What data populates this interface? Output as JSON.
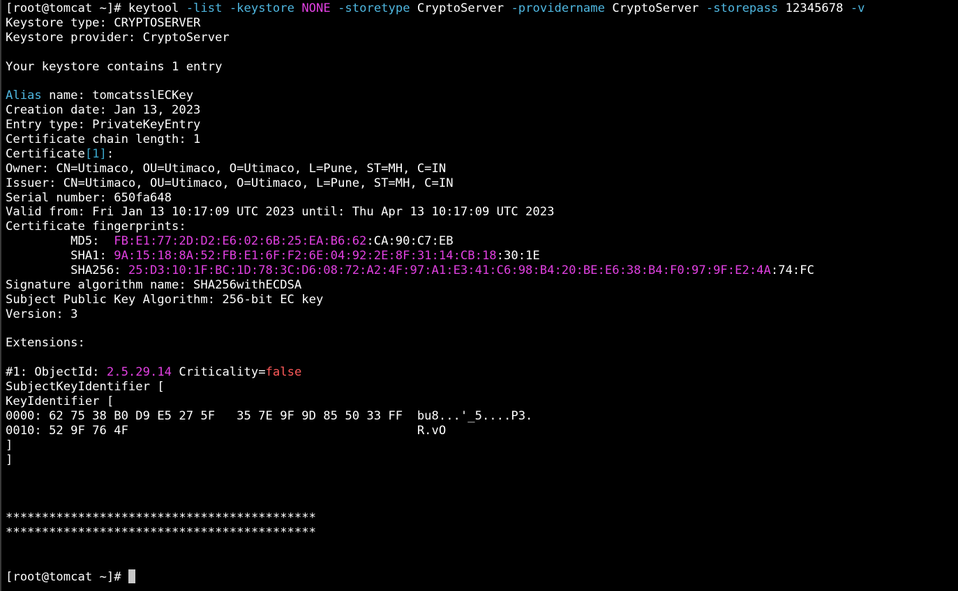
{
  "colors": {
    "background": "#000000",
    "default": "#ffffff",
    "cyan": "#4fb7e0",
    "magenta": "#e040e0",
    "red": "#ff5a5a",
    "bracket_cyan": "#3aa6c9",
    "cursor": "#c8c8c8"
  },
  "terminal": {
    "lines": [
      [
        {
          "t": "[root@tomcat ~]# keytool "
        },
        {
          "t": "-list",
          "c": "cyan"
        },
        {
          "t": " "
        },
        {
          "t": "-keystore",
          "c": "cyan"
        },
        {
          "t": " "
        },
        {
          "t": "NONE",
          "c": "magenta"
        },
        {
          "t": " "
        },
        {
          "t": "-storetype",
          "c": "cyan"
        },
        {
          "t": " CryptoServer "
        },
        {
          "t": "-providername",
          "c": "cyan"
        },
        {
          "t": " CryptoServer "
        },
        {
          "t": "-storepass",
          "c": "cyan"
        },
        {
          "t": " 12345678 "
        },
        {
          "t": "-v",
          "c": "cyan"
        }
      ],
      [
        {
          "t": "Keystore type: CRYPTOSERVER"
        }
      ],
      [
        {
          "t": "Keystore provider: CryptoServer"
        }
      ],
      [
        {
          "t": ""
        }
      ],
      [
        {
          "t": "Your keystore contains 1 entry"
        }
      ],
      [
        {
          "t": ""
        }
      ],
      [
        {
          "t": "Alias",
          "c": "cyan"
        },
        {
          "t": " name: tomcatsslECKey"
        }
      ],
      [
        {
          "t": "Creation date: Jan 13, 2023"
        }
      ],
      [
        {
          "t": "Entry type: PrivateKeyEntry"
        }
      ],
      [
        {
          "t": "Certificate chain length: 1"
        }
      ],
      [
        {
          "t": "Certificate"
        },
        {
          "t": "[1]",
          "c": "bracket_cyan"
        },
        {
          "t": ":"
        }
      ],
      [
        {
          "t": "Owner: CN=Utimaco, OU=Utimaco, O=Utimaco, L=Pune, ST=MH, C=IN"
        }
      ],
      [
        {
          "t": "Issuer: CN=Utimaco, OU=Utimaco, O=Utimaco, L=Pune, ST=MH, C=IN"
        }
      ],
      [
        {
          "t": "Serial number: 650fa648"
        }
      ],
      [
        {
          "t": "Valid from: Fri Jan 13 10:17:09 UTC 2023 until: Thu Apr 13 10:17:09 UTC 2023"
        }
      ],
      [
        {
          "t": "Certificate fingerprints:"
        }
      ],
      [
        {
          "t": "         MD5:  "
        },
        {
          "t": "FB:E1:77:2D:D2:E6:02:6B:25:EA:B6:62",
          "c": "magenta"
        },
        {
          "t": ":CA:90:C7:EB"
        }
      ],
      [
        {
          "t": "         SHA1: "
        },
        {
          "t": "9A:15:18:8A:52:FB:E1:6F:F2:6E:04:92:2E:8F:31:14:CB:18",
          "c": "magenta"
        },
        {
          "t": ":30:1E"
        }
      ],
      [
        {
          "t": "         SHA256: "
        },
        {
          "t": "25:D3:10:1F:BC:1D:78:3C:D6:08:72:A2:4F:97:A1:E3:41:C6:98:B4:20:BE:E6:38:B4:F0:97:9F:E2:4A",
          "c": "magenta"
        },
        {
          "t": ":74:FC"
        }
      ],
      [
        {
          "t": "Signature algorithm name: SHA256withECDSA"
        }
      ],
      [
        {
          "t": "Subject Public Key Algorithm: 256-bit EC key"
        }
      ],
      [
        {
          "t": "Version: 3"
        }
      ],
      [
        {
          "t": ""
        }
      ],
      [
        {
          "t": "Extensions:"
        }
      ],
      [
        {
          "t": ""
        }
      ],
      [
        {
          "t": "#1: ObjectId: "
        },
        {
          "t": "2.5.29.14",
          "c": "magenta"
        },
        {
          "t": " Criticality="
        },
        {
          "t": "false",
          "c": "red"
        }
      ],
      [
        {
          "t": "SubjectKeyIdentifier ["
        }
      ],
      [
        {
          "t": "KeyIdentifier ["
        }
      ],
      [
        {
          "t": "0000: 62 75 38 B0 D9 E5 27 5F   35 7E 9F 9D 85 50 33 FF  bu8...'_5....P3."
        }
      ],
      [
        {
          "t": "0010: 52 9F 76 4F                                        R.vO"
        }
      ],
      [
        {
          "t": "]"
        }
      ],
      [
        {
          "t": "]"
        }
      ],
      [
        {
          "t": ""
        }
      ],
      [
        {
          "t": ""
        }
      ],
      [
        {
          "t": ""
        }
      ],
      [
        {
          "t": "*******************************************"
        }
      ],
      [
        {
          "t": "*******************************************"
        }
      ],
      [
        {
          "t": ""
        }
      ],
      [
        {
          "t": ""
        }
      ],
      [
        {
          "t": "[root@tomcat ~]# "
        },
        {
          "cursor": true
        }
      ]
    ]
  }
}
